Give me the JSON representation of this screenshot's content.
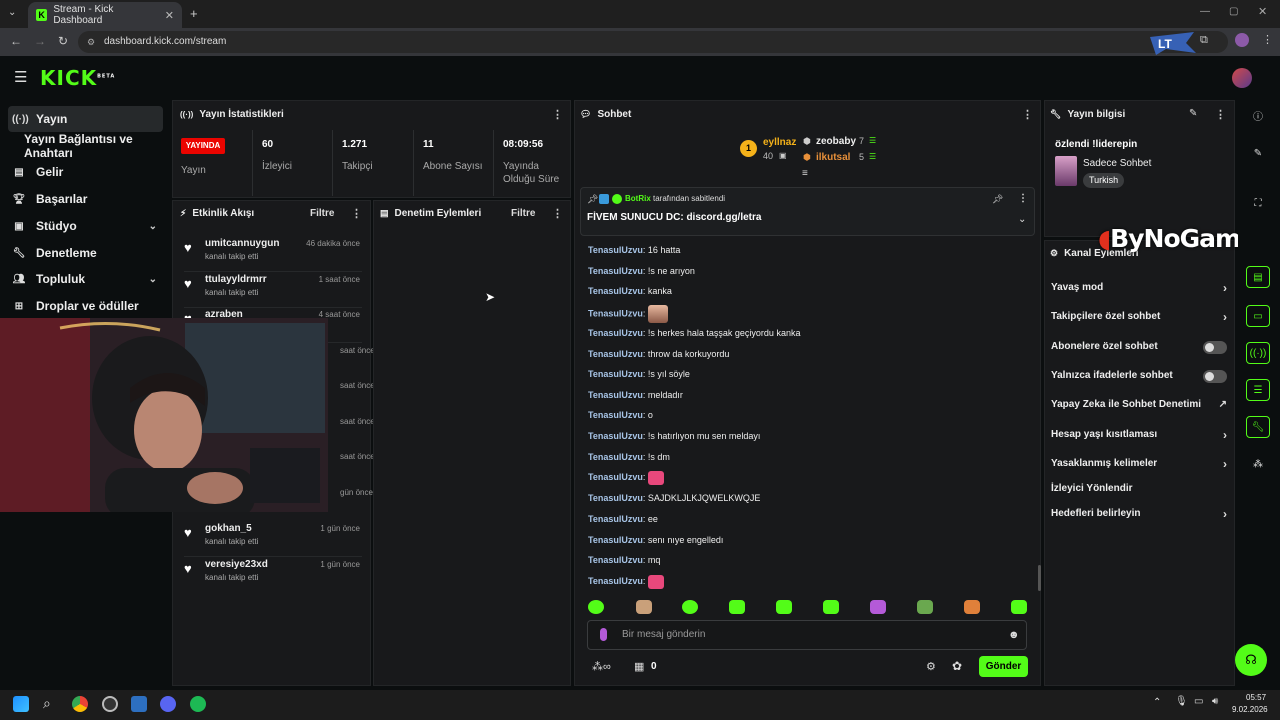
{
  "browser": {
    "tab_title": "Stream - Kick Dashboard",
    "tab_close": "✕",
    "new_tab": "+",
    "url": "dashboard.kick.com/stream"
  },
  "app": {
    "logo": "KICK",
    "logo_sup": "BETA"
  },
  "sidebar": {
    "items": [
      {
        "label": "Yayın",
        "icon": "broadcast-icon"
      },
      {
        "label": "Yayın Bağlantısı ve Anahtarı",
        "icon": ""
      },
      {
        "label": "Gelir",
        "icon": "chart-icon"
      },
      {
        "label": "Başarılar",
        "icon": "trophy-icon"
      },
      {
        "label": "Stüdyo",
        "icon": "studio-icon"
      },
      {
        "label": "Denetleme",
        "icon": "wrench-icon"
      },
      {
        "label": "Topluluk",
        "icon": "people-icon"
      },
      {
        "label": "Droplar ve ödüller",
        "icon": "gift-icon"
      }
    ]
  },
  "stats": {
    "title": "Yayın İstatistikleri",
    "live_badge": "YAYINDA",
    "live_label": "Yayın",
    "viewers_value": "60",
    "viewers_label": "İzleyici",
    "followers_value": "1.271",
    "followers_label": "Takipçi",
    "subs_value": "11",
    "subs_label": "Abone Sayısı",
    "uptime_value": "08:09:56",
    "uptime_label_1": "Yayında",
    "uptime_label_2": "Olduğu Süre"
  },
  "activity": {
    "title": "Etkinlik Akışı",
    "filter": "Filtre",
    "items": [
      {
        "name": "umitcannuygun",
        "time": "46 dakika önce",
        "action": "kanalı takip etti"
      },
      {
        "name": "ttulayyldrmrr",
        "time": "1 saat önce",
        "action": "kanalı takip etti"
      },
      {
        "name": "azraben",
        "time": "4 saat önce",
        "action": ""
      },
      {
        "name": "",
        "time": "saat önce",
        "action": ""
      },
      {
        "name": "",
        "time": "saat önce",
        "action": ""
      },
      {
        "name": "",
        "time": "saat önce",
        "action": ""
      },
      {
        "name": "",
        "time": "saat önce",
        "action": ""
      },
      {
        "name": "",
        "time": "gün önce",
        "action": ""
      },
      {
        "name": "gokhan_5",
        "time": "1 gün önce",
        "action": "kanalı takip etti"
      },
      {
        "name": "veresiye23xd",
        "time": "1 gün önce",
        "action": "kanalı takip etti"
      }
    ]
  },
  "moderation": {
    "title": "Denetim Eylemleri",
    "filter": "Filtre"
  },
  "chat": {
    "title": "Sohbet",
    "leaderboard": [
      {
        "rank": "1",
        "name": "eyllnaz",
        "count": "40"
      },
      {
        "name": "zeobaby",
        "count": "7"
      },
      {
        "name": "ilkutsal",
        "count": "5"
      }
    ],
    "pinned_by": "BotRix",
    "pinned_suffix": "tarafından sabitlendi",
    "pinned_message": "FİVEM SUNUCU DC: discord.gg/letra",
    "messages": [
      {
        "user": "TenasulUzvu",
        "text": "16 hatta"
      },
      {
        "user": "TenasulUzvu",
        "text": "!s ne arıyon"
      },
      {
        "user": "TenasulUzvu",
        "text": "kanka"
      },
      {
        "user": "TenasulUzvu",
        "text": ""
      },
      {
        "user": "TenasulUzvu",
        "text": "!s herkes hala taşşak geçiyordu kanka"
      },
      {
        "user": "TenasulUzvu",
        "text": "throw da korkuyordu"
      },
      {
        "user": "TenasulUzvu",
        "text": "!s yıl söyle"
      },
      {
        "user": "TenasulUzvu",
        "text": "meldadır"
      },
      {
        "user": "TenasulUzvu",
        "text": "o"
      },
      {
        "user": "TenasulUzvu",
        "text": "!s hatırlıyon mu sen meldayı"
      },
      {
        "user": "TenasulUzvu",
        "text": "!s dm"
      },
      {
        "user": "TenasulUzvu",
        "text": ""
      },
      {
        "user": "TenasulUzvu",
        "text": "SAJDKLJLKJQWELKWQJE"
      },
      {
        "user": "TenasulUzvu",
        "text": "ee"
      },
      {
        "user": "TenasulUzvu",
        "text": "senı nıye engelledı"
      },
      {
        "user": "TenasulUzvu",
        "text": "mq"
      },
      {
        "user": "TenasulUzvu",
        "text": ""
      }
    ],
    "separator": ":",
    "input_placeholder": "Bir mesaj gönderin",
    "points": "0",
    "send": "Gönder"
  },
  "stream_info": {
    "title": "Yayın bilgisi",
    "stream_title": "özlendi !liderepin",
    "category": "Sadece Sohbet",
    "tag": "Turkish"
  },
  "channel_actions": {
    "title": "Kanal Eylemleri",
    "items": [
      {
        "label": "Yavaş mod",
        "control": "chevron"
      },
      {
        "label": "Takipçilere özel sohbet",
        "control": "chevron"
      },
      {
        "label": "Abonelere özel sohbet",
        "control": "toggle"
      },
      {
        "label": "Yalnızca ifadelerle sohbet",
        "control": "toggle"
      },
      {
        "label": "Yapay Zeka ile Sohbet Denetimi",
        "control": "external"
      },
      {
        "label": "Hesap yaşı kısıtlaması",
        "control": "chevron"
      },
      {
        "label": "Yasaklanmış kelimeler",
        "control": "chevron"
      },
      {
        "label": "İzleyici Yönlendir",
        "control": "none"
      },
      {
        "label": "Hedefleri belirleyin",
        "control": "chevron"
      }
    ]
  },
  "watermark": "ByNoGame",
  "taskbar": {
    "time": "05:57",
    "date": "9.02.2026"
  },
  "colors": {
    "accent": "#53fc18",
    "live": "#eb0400",
    "background": "#0b0e0f",
    "panel": "#18191b"
  }
}
